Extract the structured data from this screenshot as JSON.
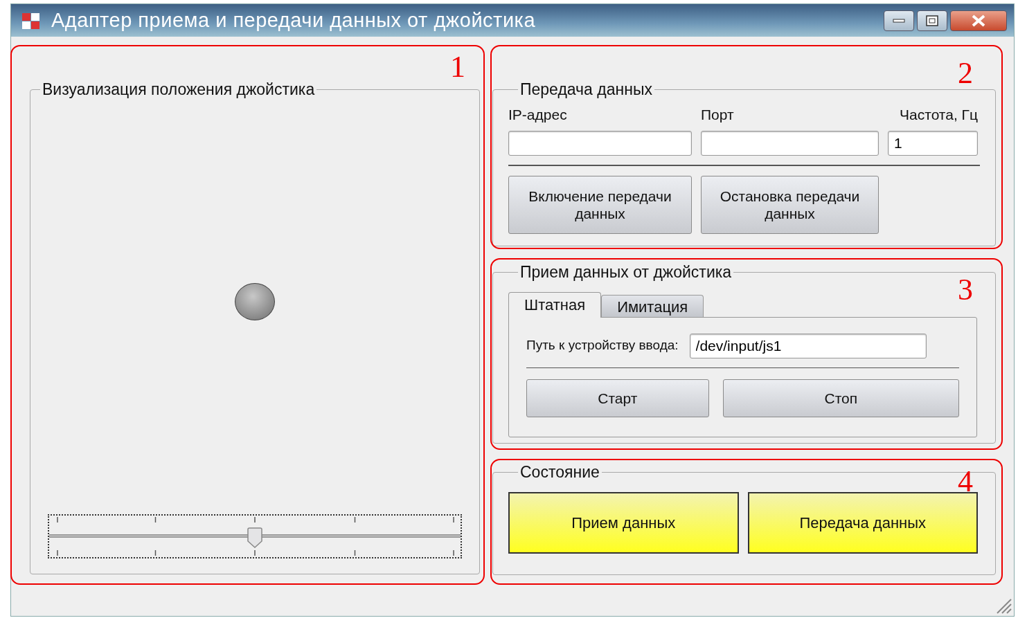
{
  "window": {
    "title": "Адаптер приема и передачи данных от джойстика"
  },
  "joystick_view": {
    "title": "Визуализация положения джойстика",
    "annotation": "1",
    "slider": {
      "level": 0.5
    }
  },
  "transmission": {
    "title": "Передача данных",
    "annotation": "2",
    "fields": [
      {
        "label": "IP-адрес"
      },
      {
        "label": "Порт"
      },
      {
        "label": "Частота, Гц",
        "value": "1"
      }
    ],
    "buttons": [
      "Включение передачи данных",
      "Остановка передачи данных"
    ]
  },
  "reception": {
    "title": "Прием данных от джойстика",
    "annotation": "3",
    "tabs": [
      {
        "label": "Штатная",
        "selected": true
      },
      {
        "label": "Имитация",
        "selected": false
      }
    ],
    "device_label": "Путь к устройству ввода:",
    "device_value": "/dev/input/js1",
    "buttons": [
      "Старт",
      "Стоп"
    ]
  },
  "status": {
    "title": "Состояние",
    "annotation": "4",
    "indicators": [
      {
        "label": "Прием данных",
        "on": true
      },
      {
        "label": "Передача данных",
        "on": true
      }
    ]
  }
}
